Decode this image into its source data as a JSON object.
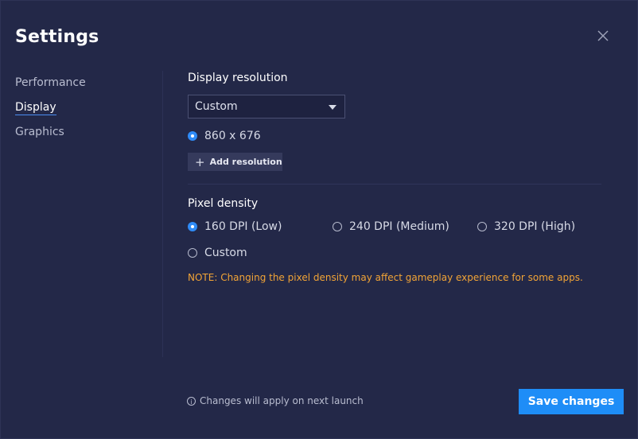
{
  "window": {
    "title": "Settings"
  },
  "sidebar": {
    "items": [
      {
        "label": "Performance",
        "active": false
      },
      {
        "label": "Display",
        "active": true
      },
      {
        "label": "Graphics",
        "active": false
      }
    ]
  },
  "display_resolution": {
    "label": "Display resolution",
    "selected_option": "Custom",
    "resolution_option": "860 x 676",
    "add_button_label": "Add resolution"
  },
  "pixel_density": {
    "label": "Pixel density",
    "options": [
      {
        "label": "160 DPI (Low)",
        "checked": true
      },
      {
        "label": "240 DPI (Medium)",
        "checked": false
      },
      {
        "label": "320 DPI (High)",
        "checked": false
      },
      {
        "label": "Custom",
        "checked": false
      }
    ],
    "note": "NOTE: Changing the pixel density may affect gameplay experience for some apps."
  },
  "footer": {
    "info_text": "Changes will apply on next launch",
    "save_label": "Save changes"
  },
  "colors": {
    "accent": "#1e8df7",
    "warning": "#f2a436",
    "background": "#232848"
  }
}
